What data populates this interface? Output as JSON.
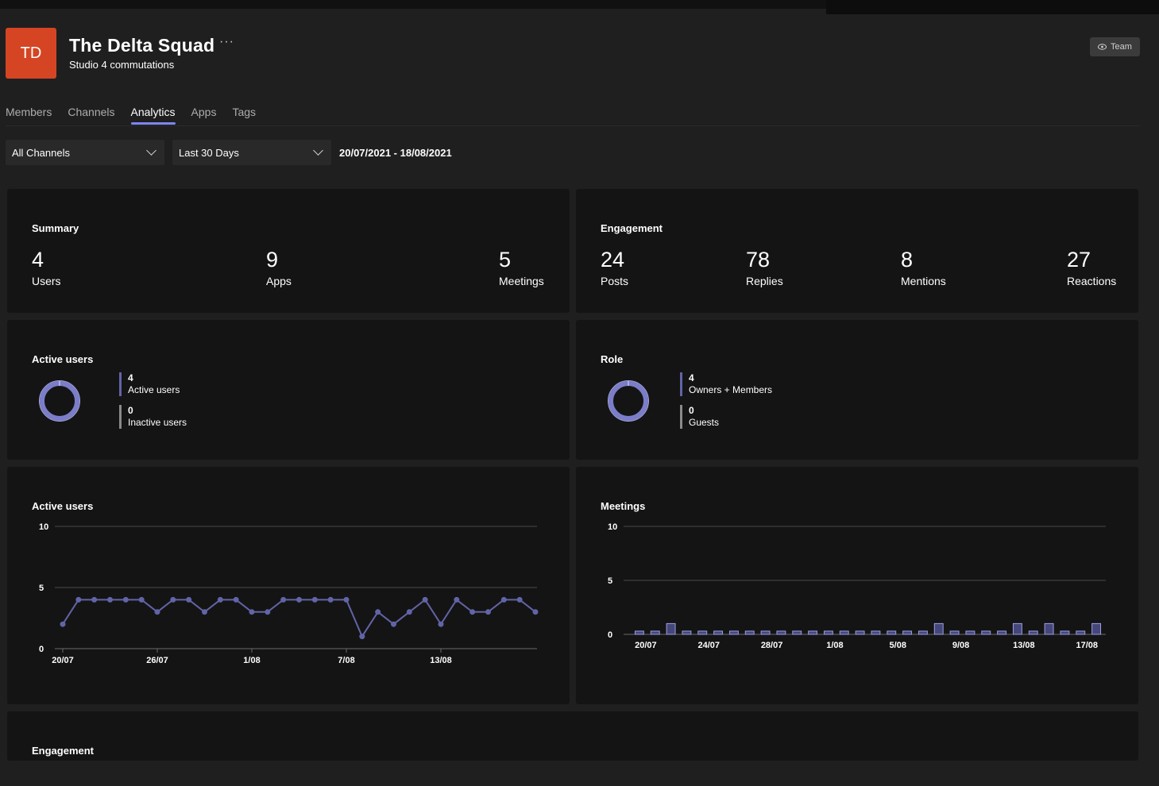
{
  "team": {
    "initials": "TD",
    "name": "The Delta Squad",
    "more_label": "···",
    "subtitle": "Studio 4 commutations",
    "team_button": "Team",
    "avatar_color": "#d54523"
  },
  "tabs": [
    "Members",
    "Channels",
    "Analytics",
    "Apps",
    "Tags"
  ],
  "active_tab": "Analytics",
  "filters": {
    "channel": "All Channels",
    "period": "Last 30 Days",
    "date_range": "20/07/2021 - 18/08/2021"
  },
  "summary": {
    "title": "Summary",
    "stats": [
      {
        "value": "4",
        "label": "Users"
      },
      {
        "value": "9",
        "label": "Apps"
      },
      {
        "value": "5",
        "label": "Meetings"
      }
    ]
  },
  "engagement": {
    "title": "Engagement",
    "stats": [
      {
        "value": "24",
        "label": "Posts"
      },
      {
        "value": "78",
        "label": "Replies"
      },
      {
        "value": "8",
        "label": "Mentions"
      },
      {
        "value": "27",
        "label": "Reactions"
      }
    ]
  },
  "active_users_donut": {
    "title": "Active users",
    "items": [
      {
        "value": "4",
        "label": "Active users"
      },
      {
        "value": "0",
        "label": "Inactive users"
      }
    ]
  },
  "role_donut": {
    "title": "Role",
    "items": [
      {
        "value": "4",
        "label": "Owners + Members"
      },
      {
        "value": "0",
        "label": "Guests"
      }
    ]
  },
  "engagement_section": {
    "title": "Engagement"
  },
  "colors": {
    "accent": "#6264a7",
    "series": "#6264a7",
    "tab_underline": "#7f85f5"
  },
  "chart_data": [
    {
      "type": "line",
      "title": "Active users",
      "x_tick_labels": [
        "20/07",
        "26/07",
        "1/08",
        "7/08",
        "13/08"
      ],
      "x": [
        "20/07",
        "21/07",
        "22/07",
        "23/07",
        "24/07",
        "25/07",
        "26/07",
        "27/07",
        "28/07",
        "29/07",
        "30/07",
        "31/07",
        "1/08",
        "2/08",
        "3/08",
        "4/08",
        "5/08",
        "6/08",
        "7/08",
        "8/08",
        "9/08",
        "10/08",
        "11/08",
        "12/08",
        "13/08",
        "14/08",
        "15/08",
        "16/08",
        "17/08",
        "18/08",
        "19/08"
      ],
      "values": [
        2,
        4,
        4,
        4,
        4,
        4,
        3,
        4,
        4,
        3,
        4,
        4,
        3,
        3,
        4,
        4,
        4,
        4,
        4,
        1,
        3,
        2,
        3,
        4,
        2,
        4,
        3,
        3,
        4,
        4,
        3
      ],
      "ylim": [
        0,
        10
      ],
      "y_ticks": [
        0,
        5,
        10
      ],
      "grid": true
    },
    {
      "type": "bar",
      "title": "Meetings",
      "x_tick_labels": [
        "20/07",
        "24/07",
        "28/07",
        "1/08",
        "5/08",
        "9/08",
        "13/08",
        "17/08"
      ],
      "values": [
        0.3,
        0.3,
        1,
        0.3,
        0.3,
        0.3,
        0.3,
        0.3,
        0.3,
        0.3,
        0.3,
        0.3,
        0.3,
        0.3,
        0.3,
        0.3,
        0.3,
        0.3,
        0.3,
        1,
        0.3,
        0.3,
        0.3,
        0.3,
        1,
        0.3,
        1,
        0.3,
        0.3,
        1
      ],
      "ylim": [
        0,
        10
      ],
      "y_ticks": [
        0,
        5,
        10
      ],
      "grid": true
    }
  ]
}
